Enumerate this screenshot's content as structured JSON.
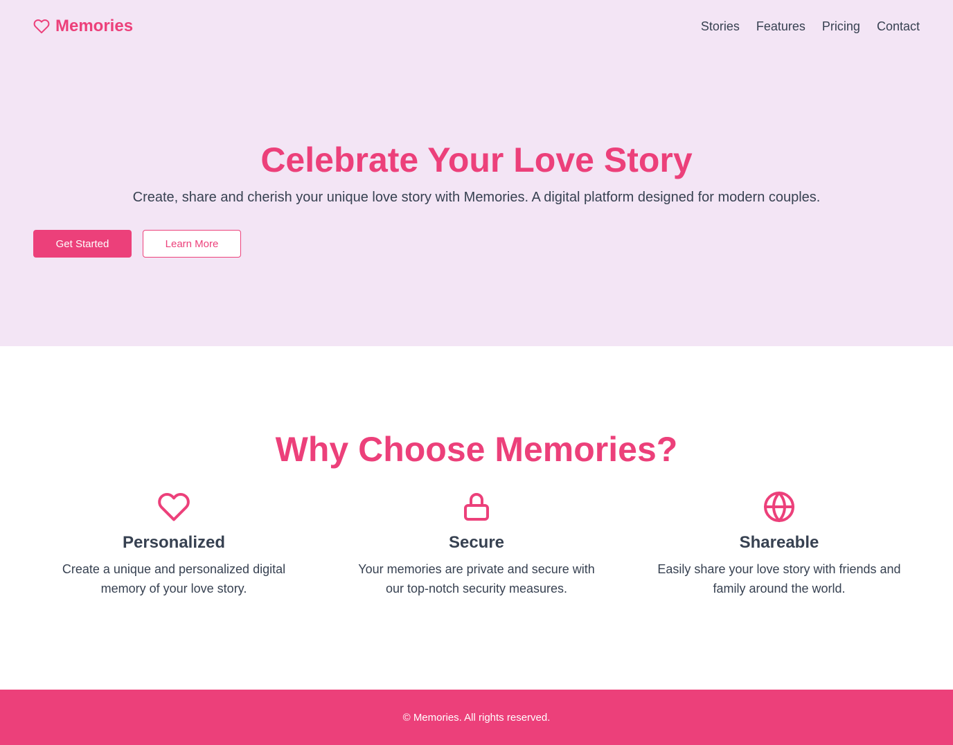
{
  "nav": {
    "brand": "Memories",
    "brand_icon": "heart-icon",
    "links": [
      "Stories",
      "Features",
      "Pricing",
      "Contact"
    ]
  },
  "hero": {
    "title": "Celebrate Your Love Story",
    "subtitle": "Create, share and cherish your unique love story with Memories. A digital platform designed for modern couples.",
    "primary_button": "Get Started",
    "secondary_button": "Learn More"
  },
  "features": {
    "title": "Why Choose Memories?",
    "items": [
      {
        "icon": "heart-icon",
        "title": "Personalized",
        "description": "Create a unique and personalized digital memory of your love story."
      },
      {
        "icon": "lock-icon",
        "title": "Secure",
        "description": "Your memories are private and secure with our top-notch security measures."
      },
      {
        "icon": "globe-icon",
        "title": "Shareable",
        "description": "Easily share your love story with friends and family around the world."
      }
    ]
  },
  "footer": {
    "text": "© Memories. All rights reserved."
  },
  "colors": {
    "accent": "#ec407a",
    "hero_bg": "#f3e5f5",
    "text": "#374151"
  }
}
